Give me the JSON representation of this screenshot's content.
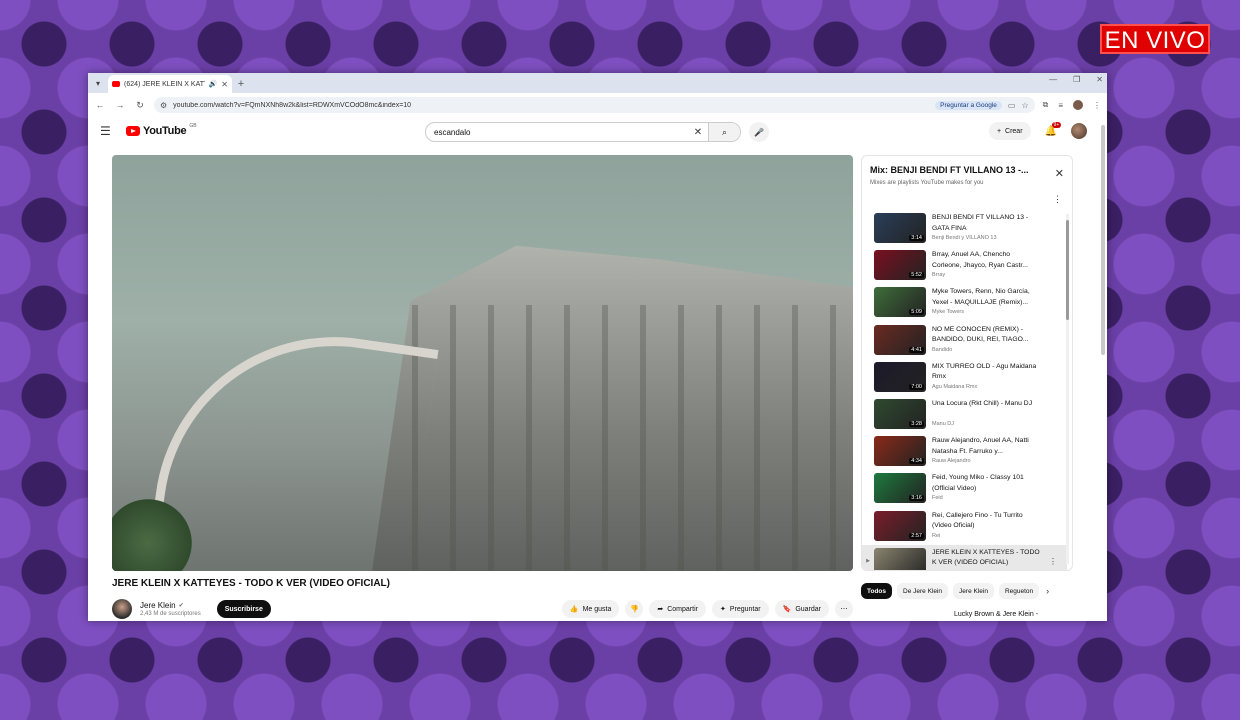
{
  "overlay": {
    "live_label": "EN VIVO"
  },
  "browser": {
    "tab_title": "(624) JERE KLEIN X KATTEYE",
    "url": "youtube.com/watch?v=FQmNXNh8w2k&list=RDWXmVCOdO8mc&index=10",
    "ask_google": "Preguntar a Google"
  },
  "header": {
    "logo": "YouTube",
    "logo_country": "GB",
    "search_value": "escandalo",
    "create_label": "Crear",
    "notif_count": "9+"
  },
  "video": {
    "title": "JERE KLEIN X KATTEYES - TODO K VER (VIDEO OFICIAL)",
    "channel": "Jere Klein",
    "subscribers": "2,43 M de suscriptores",
    "subscribe_label": "Suscribirse",
    "like_label": "Me gusta",
    "share_label": "Compartir",
    "ask_label": "Preguntar",
    "save_label": "Guardar"
  },
  "playlist": {
    "title": "Mix: BENJI BENDI FT VILLANO 13 -...",
    "subtitle": "Mixes are playlists YouTube makes for you",
    "items": [
      {
        "title": "BENJI BENDI FT VILLANO 13 - GATA FINA",
        "channel": "Benji Bendi y VILLANO 13",
        "duration": "3:14",
        "color": "#2a3f5a"
      },
      {
        "title": "Brray, Anuel AA, Chencho Corleone, Jhayco, Ryan Castr...",
        "channel": "Brray",
        "duration": "5:52",
        "color": "#7a1020"
      },
      {
        "title": "Myke Towers, Renn, Nio García, Yexel - MAQUILLAJE (Remix)...",
        "channel": "Myke Towers",
        "duration": "5:09",
        "color": "#3f6e3a"
      },
      {
        "title": "NO ME CONOCEN (REMIX) - BANDIDO, DUKI, REI, TIAGO...",
        "channel": "Bandido",
        "duration": "4:41",
        "color": "#6b2a22"
      },
      {
        "title": "MIX TURREO OLD - Agu Maidana Rmx",
        "channel": "Agu Maidana Rmx",
        "duration": "7:00",
        "color": "#1d1a2a"
      },
      {
        "title": "Una Locura (Rkt Chill) - Manu DJ",
        "channel": "Manu DJ",
        "duration": "3:28",
        "color": "#2f4a30"
      },
      {
        "title": "Rauw Alejandro, Anuel AA, Natti Natasha Ft. Farruko y...",
        "channel": "Rauw Alejandro",
        "duration": "4:34",
        "color": "#8a2a18"
      },
      {
        "title": "Feid, Young Miko - Classy 101 (Official Video)",
        "channel": "Feid",
        "duration": "3:16",
        "color": "#1e7a3e"
      },
      {
        "title": "Rei, Callejero Fino - Tu Turrito (Video Oficial)",
        "channel": "Rei",
        "duration": "2:57",
        "color": "#7a1e2a"
      },
      {
        "title": "JERE KLEIN X KATTEYES - TODO K VER (VIDEO OFICIAL)",
        "channel": "",
        "duration": "2:39",
        "color": "#8a8570"
      }
    ]
  },
  "chips": [
    "Todos",
    "De Jere Klein",
    "Jere Klein",
    "Regueton"
  ],
  "recommendation_peek": "Lucky Brown & Jere Klein -"
}
